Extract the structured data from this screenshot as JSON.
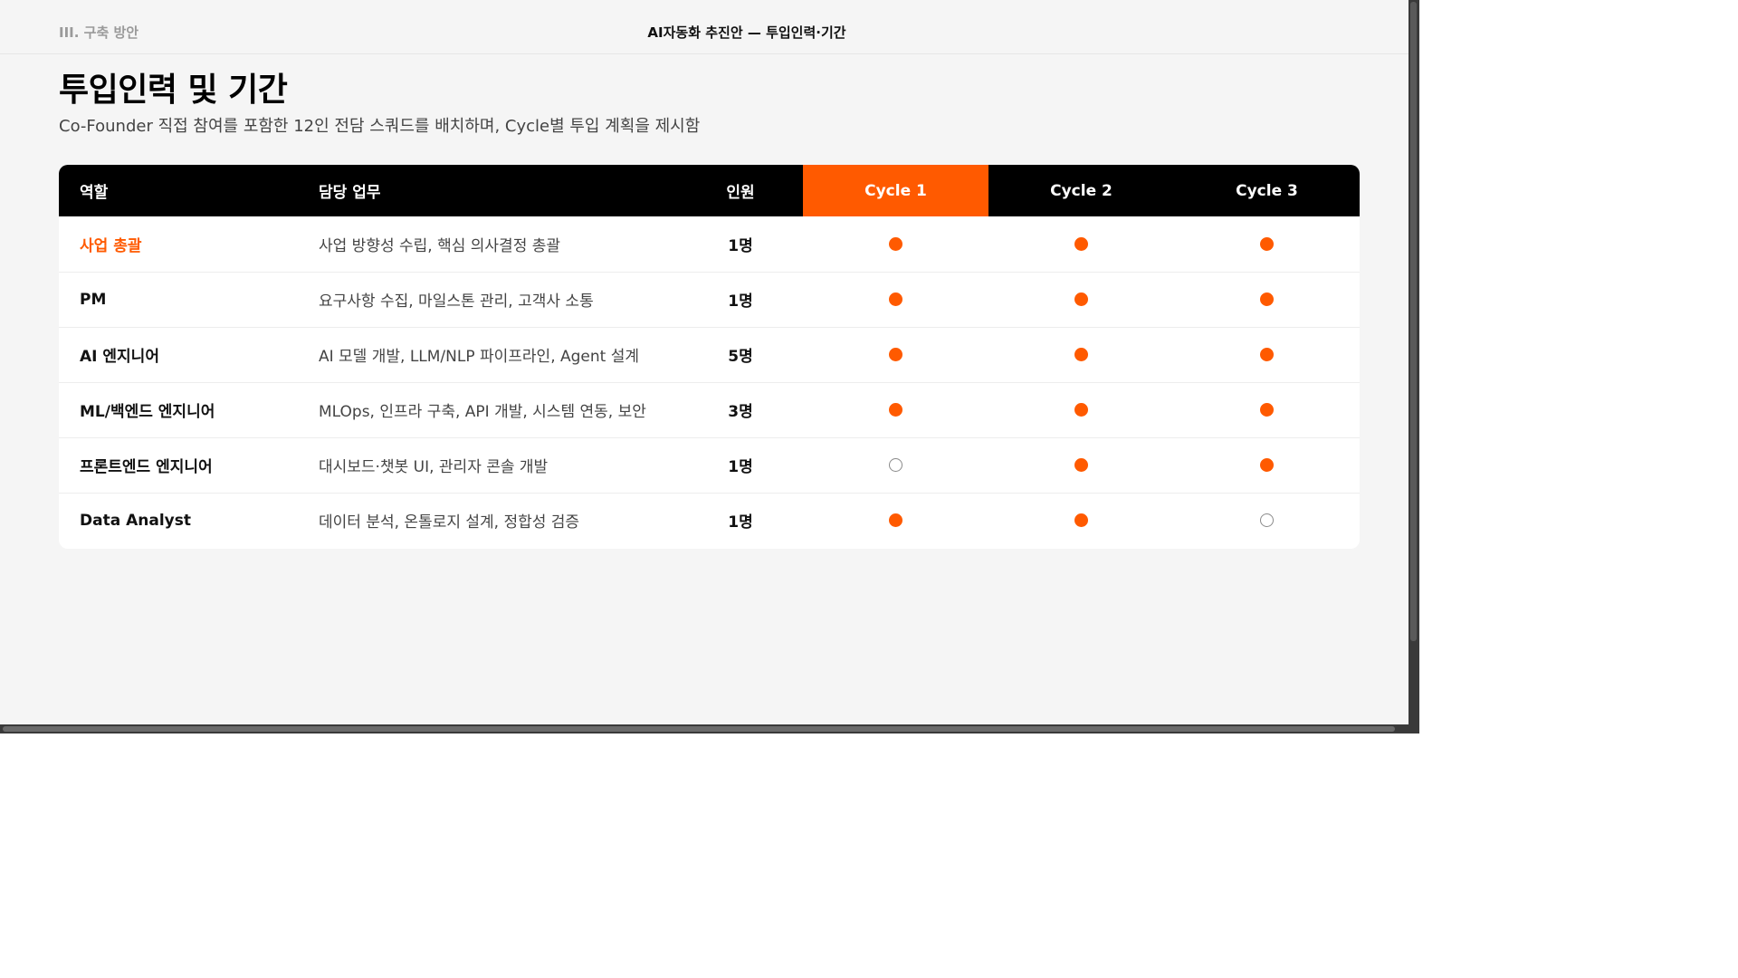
{
  "header": {
    "section": "III. 구축 방안",
    "doc_title": "AI자동화 추진안 — 투입인력·기간"
  },
  "page": {
    "title": "투입인력 및 기간",
    "subtitle": "Co-Founder 직접 참여를 포함한 12인 전담 스쿼드를 배치하며, Cycle별 투입 계획을 제시함"
  },
  "table": {
    "columns": {
      "role": "역할",
      "duty": "담당 업무",
      "headcount": "인원",
      "cycle1": "Cycle 1",
      "cycle2": "Cycle 2",
      "cycle3": "Cycle 3"
    },
    "rows": [
      {
        "role": "사업 총괄",
        "duty": "사업 방향성 수립, 핵심 의사결정 총괄",
        "headcount": "1명",
        "cycle1": true,
        "cycle2": true,
        "cycle3": true
      },
      {
        "role": "PM",
        "duty": "요구사항 수집, 마일스톤 관리, 고객사 소통",
        "headcount": "1명",
        "cycle1": true,
        "cycle2": true,
        "cycle3": true
      },
      {
        "role": "AI 엔지니어",
        "duty": "AI 모델 개발, LLM/NLP 파이프라인, Agent 설계",
        "headcount": "5명",
        "cycle1": true,
        "cycle2": true,
        "cycle3": true
      },
      {
        "role": "ML/백엔드 엔지니어",
        "duty": "MLOps, 인프라 구축, API 개발, 시스템 연동, 보안",
        "headcount": "3명",
        "cycle1": true,
        "cycle2": true,
        "cycle3": true
      },
      {
        "role": "프론트엔드 엔지니어",
        "duty": "대시보드·챗봇 UI, 관리자 콘솔 개발",
        "headcount": "1명",
        "cycle1": false,
        "cycle2": true,
        "cycle3": true
      },
      {
        "role": "Data Analyst",
        "duty": "데이터 분석, 온톨로지 설계, 정합성 검증",
        "headcount": "1명",
        "cycle1": true,
        "cycle2": true,
        "cycle3": false
      }
    ]
  },
  "colors": {
    "accent": "#ff5a00",
    "header_bg": "#000000",
    "page_bg": "#f5f5f5"
  }
}
